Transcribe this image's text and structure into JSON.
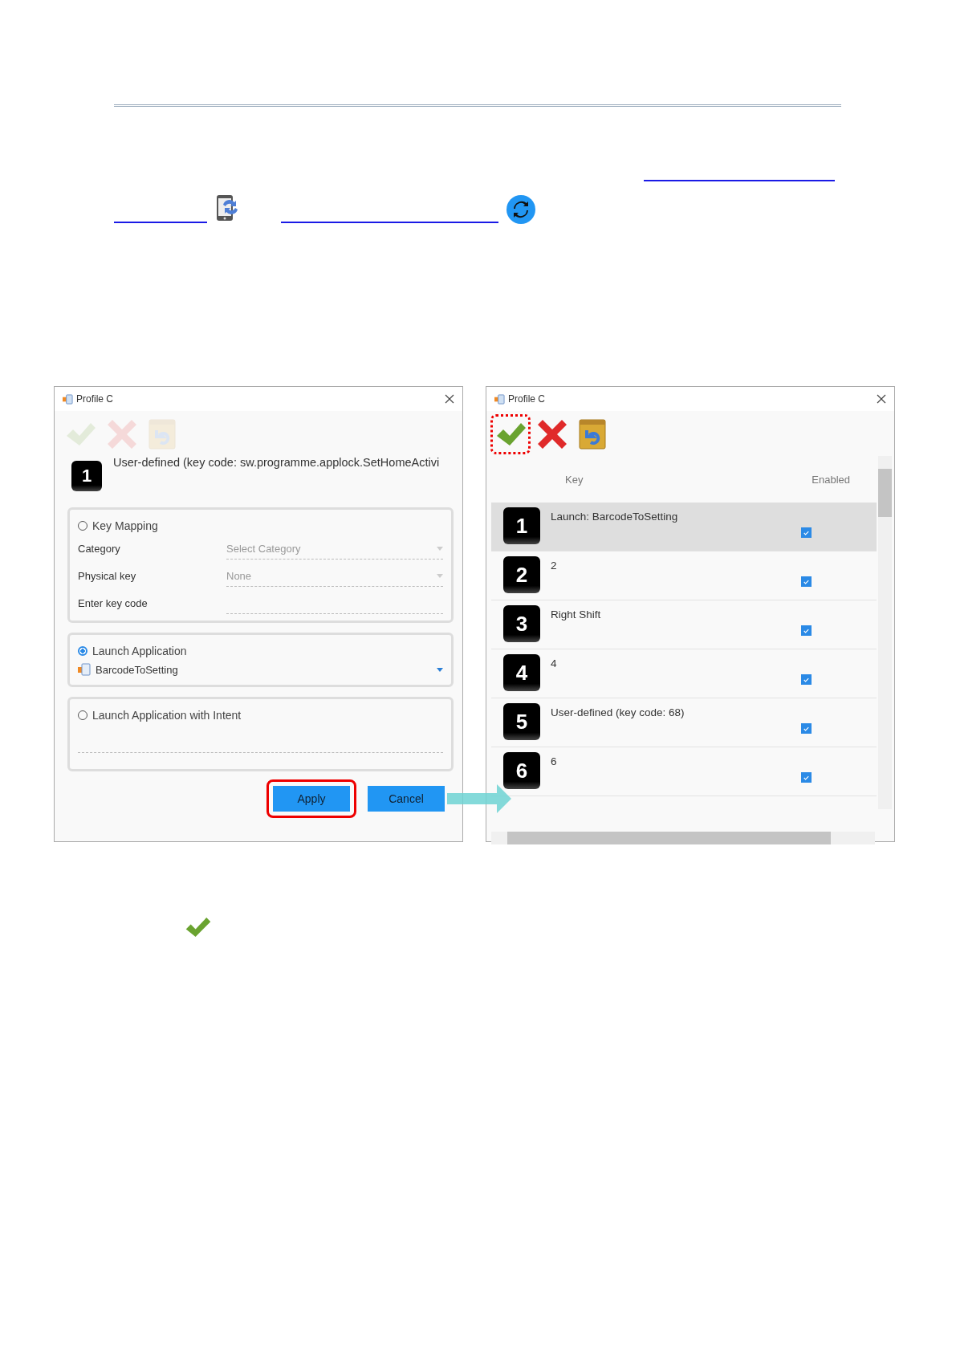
{
  "left_dialog": {
    "title": "Profile C",
    "toolbar": [
      {
        "kind": "apply",
        "disabled": true,
        "highlighted": false
      },
      {
        "kind": "discard",
        "disabled": true,
        "highlighted": false
      },
      {
        "kind": "restore",
        "disabled": true,
        "highlighted": false
      }
    ],
    "key_number": "1",
    "key_label": "User-defined (key code: sw.programme.applock.SetHomeActivi",
    "options": [
      {
        "kind": "key_mapping",
        "label": "Key Mapping",
        "selected": false,
        "fields": [
          {
            "kind": "dropdown",
            "label": "Category",
            "placeholder": "Select Category"
          },
          {
            "kind": "dropdown",
            "label": "Physical key",
            "value": "None"
          },
          {
            "kind": "text",
            "label": "Enter key code"
          }
        ]
      },
      {
        "kind": "launch_app",
        "label": "Launch Application",
        "selected": true,
        "app": "BarcodeToSetting"
      },
      {
        "kind": "launch_intent",
        "label": "Launch Application with Intent",
        "selected": false
      }
    ],
    "buttons": [
      {
        "label": "Apply",
        "highlighted": true
      },
      {
        "label": "Cancel",
        "highlighted": false
      }
    ]
  },
  "right_dialog": {
    "title": "Profile C",
    "toolbar": [
      {
        "kind": "apply",
        "disabled": false,
        "highlighted": true
      },
      {
        "kind": "discard",
        "disabled": false,
        "highlighted": false
      },
      {
        "kind": "restore",
        "disabled": false,
        "highlighted": false
      }
    ],
    "columns": [
      "Key",
      "Enabled"
    ],
    "rows": [
      {
        "number": "1",
        "label": "Launch: BarcodeToSetting",
        "enabled": true,
        "selected": true
      },
      {
        "number": "2",
        "label": "2",
        "enabled": true,
        "selected": false
      },
      {
        "number": "3",
        "label": "Right Shift",
        "enabled": true,
        "selected": false
      },
      {
        "number": "4",
        "label": "4",
        "enabled": true,
        "selected": false
      },
      {
        "number": "5",
        "label": "User-defined (key code: 68)",
        "enabled": true,
        "selected": false
      },
      {
        "number": "6",
        "label": "6",
        "enabled": true,
        "selected": false
      }
    ]
  }
}
